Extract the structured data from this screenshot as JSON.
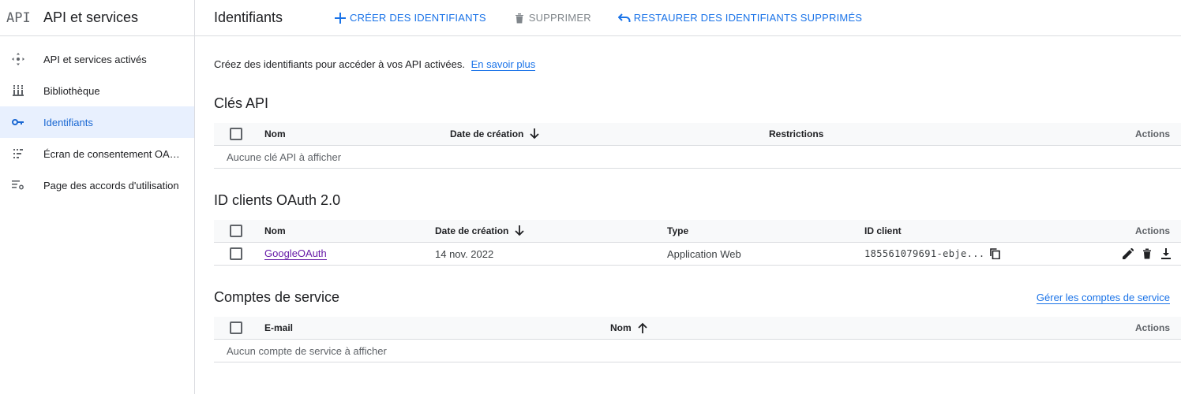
{
  "sidebar": {
    "logo": "API",
    "title": "API et services",
    "items": [
      {
        "label": "API et services activés",
        "icon": "api-diamond-icon",
        "active": false
      },
      {
        "label": "Bibliothèque",
        "icon": "library-icon",
        "active": false
      },
      {
        "label": "Identifiants",
        "icon": "key-icon",
        "active": true
      },
      {
        "label": "Écran de consentement OAuth",
        "icon": "consent-screen-icon",
        "active": false
      },
      {
        "label": "Page des accords d'utilisation",
        "icon": "settings-list-icon",
        "active": false
      }
    ]
  },
  "toolbar": {
    "title": "Identifiants",
    "create_label": "CRÉER DES IDENTIFIANTS",
    "delete_label": "SUPPRIMER",
    "restore_label": "RESTAURER DES IDENTIFIANTS SUPPRIMÉS"
  },
  "intro": {
    "text": "Créez des identifiants pour accéder à vos API activées.",
    "link": "En savoir plus"
  },
  "api_keys": {
    "title": "Clés API",
    "columns": [
      "Nom",
      "Date de création",
      "Restrictions",
      "Actions"
    ],
    "empty": "Aucune clé API à afficher"
  },
  "oauth": {
    "title": "ID clients OAuth 2.0",
    "columns": [
      "Nom",
      "Date de création",
      "Type",
      "ID client",
      "Actions"
    ],
    "rows": [
      {
        "name": "GoogleOAuth",
        "created": "14 nov. 2022",
        "type": "Application Web",
        "client_id": "185561079691-ebje..."
      }
    ]
  },
  "service_accounts": {
    "title": "Comptes de service",
    "manage_link": "Gérer les comptes de service",
    "columns": [
      "E-mail",
      "Nom",
      "Actions"
    ],
    "empty": "Aucun compte de service à afficher"
  },
  "colors": {
    "accent": "#1a73e8",
    "active_bg": "#e8f0fe",
    "visited_link": "#681da8"
  }
}
